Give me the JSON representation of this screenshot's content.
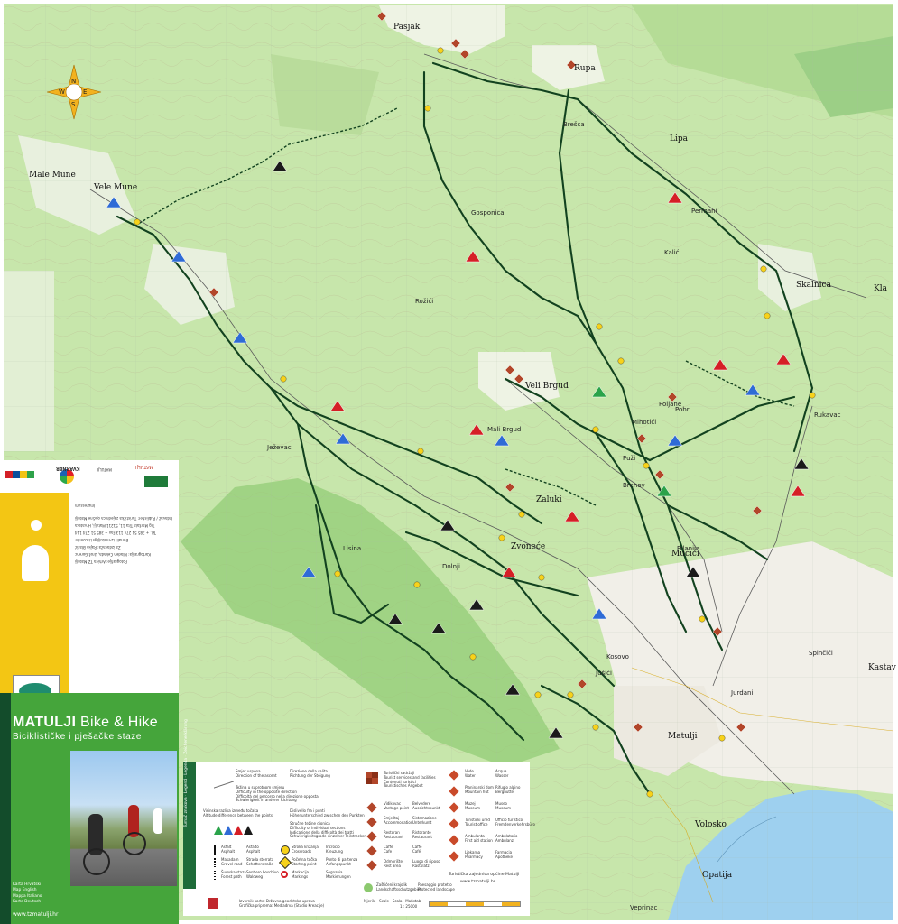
{
  "title": {
    "part1": "MATULJI",
    "part2": "Bike & Hike",
    "subtitle": "Biciklističke i pješačke staze"
  },
  "website": "www.tzmatulji.hr",
  "languages": [
    "Karta  Hrvatski",
    "Map  English",
    "Mappa  Italiano",
    "Karte  Deutsch"
  ],
  "side_logos": [
    "KVARNER",
    "MATULJI",
    "MATULJI"
  ],
  "side_panel_text": [
    "Izdavač / Publisher: Turistička zajednica općine Matulji",
    "Trg Maršala Tita 11, 51211 Matulji, Hrvatska",
    "Tel. + 385 51 274 113  Fax + 385 51 274 114",
    "E-mail: tz-matulji@ri.t-com.hr",
    "Za izdavača: Rajko Blažić",
    "Kartografija: Mladen Čekada, Uroš Gorenc",
    "Fotografije: Arhiva TZ Matulji",
    "Impressum"
  ],
  "place_names": {
    "Pasjak": "Pasjak",
    "Rupa": "Rupa",
    "Lipa": "Lipa",
    "MaleMune": "Male Mune",
    "VeleMune": "Vele Mune",
    "Skalnica": "Skalnica",
    "Klana": "Kla",
    "VeliBrgud": "Veli Brgud",
    "Zaluki": "Zaluki",
    "Brehov": "Brehov",
    "Zvoneće": "Zvoneće",
    "Mučići": "Mučići",
    "Kastav": "Kastav",
    "Matulji": "Matulji",
    "Volosko": "Volosko",
    "Opatija": "Opatija",
    "Veprinac": "Veprinac",
    "Spinčići": "Spinčići",
    "Kalić": "Kalić",
    "Jurdani": "Jurdani",
    "Jušići": "Jušići",
    "Brešca": "Brešca",
    "MaliBrgud": "Mali Brgud",
    "Pobri": "Pobri",
    "Mihotići": "Mihotići",
    "Permani": "Permani",
    "Rukavac": "Rukavac",
    "Frlanija": "Frlanija",
    "Puži": "Puži",
    "Gosponica": "Gosponica",
    "Dolnji": "Dolnji",
    "Ježevac": "Ježevac",
    "Lisina": "Lisina",
    "Rožići": "Rožići",
    "Poljane": "Poljane",
    "Kosovo": "Kosovo"
  },
  "legend": {
    "header": "Tumač znakova · Legend · Legenda · Zeichenerklärung",
    "items": [
      {
        "hr": "Smjer uspona",
        "en": "Direction of the ascent",
        "it": "Direzione della salita",
        "de": "Richtung der Steigung"
      },
      {
        "hr": "Težina u suprotnom smjeru",
        "en": "Difficulty in the opposite direction",
        "it": "Difficoltà del percorso nella direzione opposta",
        "de": "Schwierigkeit in anderer Richtung"
      },
      {
        "hr": "Visinska razlika između točaka",
        "en": "Altitude difference between the points",
        "it": "Dislivello fra i punti",
        "de": "Höhenunterschied zwischen den Punkten"
      },
      {
        "hr": "Stručne težine dionica",
        "en": "Difficulty of individual sections",
        "it": "Indicazione della difficoltà dei tratti",
        "de": "Schwierigkeitsgrade einzelner Teilstrecken"
      },
      {
        "hr": "Asfalt",
        "en": "Asphalt",
        "it": "Asfalto",
        "de": "Asphalt"
      },
      {
        "hr": "Makadam",
        "en": "Gravel road",
        "it": "Strada sterrata",
        "de": "Schotterstraße"
      },
      {
        "hr": "Šumska staza",
        "en": "Forest path",
        "it": "Sentiero boschivo",
        "de": "Waldweg"
      },
      {
        "hr": "Stroka križanja",
        "en": "Crossroads",
        "it": "Incrocio",
        "de": "Kreuzung"
      },
      {
        "hr": "Početna točka",
        "en": "Starting point",
        "it": "Punto di partenza",
        "de": "Anfangspunkt"
      },
      {
        "hr": "Markacija",
        "en": "Markings",
        "it": "Segnavia",
        "de": "Markierungen"
      },
      {
        "hr": "Zaštićeni krajolik",
        "en": "Protected landscape",
        "it": "Paesaggio protetto",
        "de": "Landschaftsschutzgebiet"
      },
      {
        "hr": "Turistički sadržaji",
        "en": "Tourist services and facilities",
        "it": "Contenuti turistici",
        "de": "Touristisches Angebot"
      },
      {
        "hr": "Vidikovac",
        "en": "Vantage point",
        "it": "Belvedere",
        "de": "Aussichtspunkt"
      },
      {
        "hr": "Smještaj",
        "en": "Accommodation",
        "it": "Sistemazione",
        "de": "Unterkunft"
      },
      {
        "hr": "Restoran",
        "en": "Restaurant",
        "it": "Ristorante",
        "de": "Restaurant"
      },
      {
        "hr": "Caffe",
        "en": "Cafe",
        "it": "Caffè",
        "de": "Café"
      },
      {
        "hr": "Odmorište",
        "en": "Rest area",
        "it": "Luogo di riposo",
        "de": "Rastplatz"
      },
      {
        "hr": "Vode",
        "en": "Water",
        "it": "Acqua",
        "de": "Wasser"
      },
      {
        "hr": "Planinarski dom",
        "en": "Mountain hut",
        "it": "Rifugio alpino",
        "de": "Berghütte"
      },
      {
        "hr": "Muzej",
        "en": "Museum",
        "it": "Museo",
        "de": "Museum"
      },
      {
        "hr": "Turistički ured",
        "en": "Tourist office",
        "it": "Ufficio turistico",
        "de": "Fremdenverkehrsbüro"
      },
      {
        "hr": "Ambulanta",
        "en": "First aid station",
        "it": "Ambulatorio",
        "de": "Ambulanz"
      },
      {
        "hr": "Ljekarna",
        "en": "Pharmacy",
        "it": "Farmacia",
        "de": "Apotheke"
      }
    ],
    "publisher": "Turistička zajednica općine Matulji",
    "publisher_web": "www.tzmatulji.hr",
    "scale_label": "Mjerilo · Scale · Scala · Maßstab",
    "scale_value": "1 : 25000",
    "cartography": [
      "Izvornik karte: Državna geodetska uprava",
      "Grafička priprema: Mediadrva (Studio Kreacije)"
    ]
  },
  "colors": {
    "route": "#12421f",
    "map_green": "#c4e5a9",
    "protected": "#8cc96f",
    "sea": "#9ed0ef",
    "accent_yellow": "#f3c614",
    "accent_green": "#45a53b"
  },
  "icons": [
    "compass-rose-icon",
    "difficulty-triangle-icon",
    "waypoint-marker-icon",
    "tourist-service-icon"
  ]
}
